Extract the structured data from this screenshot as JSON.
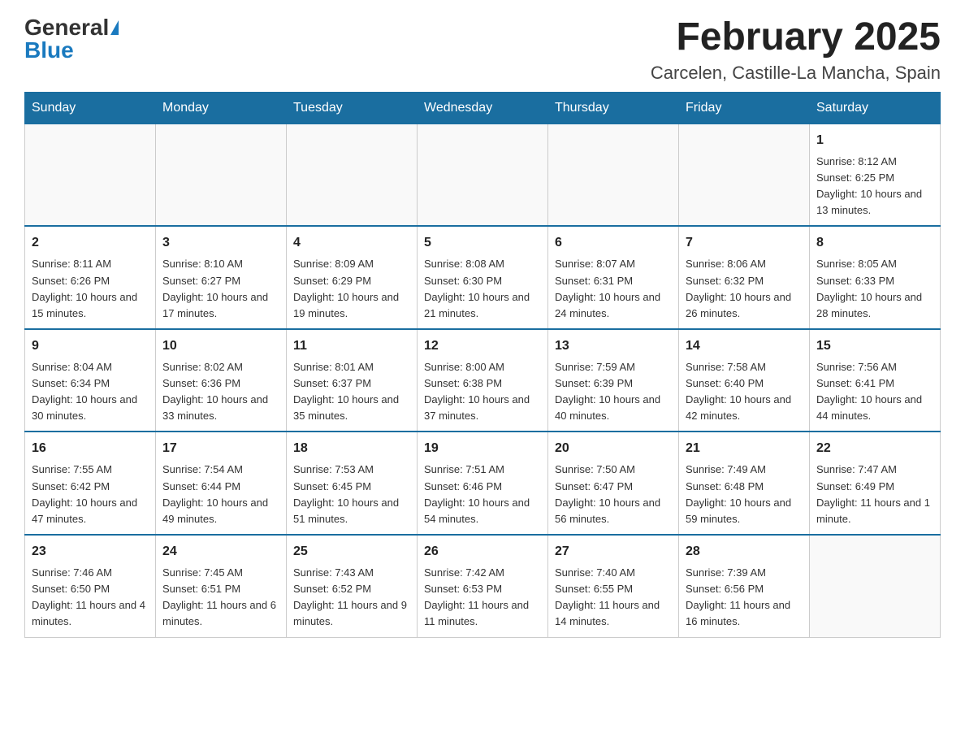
{
  "header": {
    "logo_general": "General",
    "logo_blue": "Blue",
    "month_title": "February 2025",
    "location": "Carcelen, Castille-La Mancha, Spain"
  },
  "days_of_week": [
    "Sunday",
    "Monday",
    "Tuesday",
    "Wednesday",
    "Thursday",
    "Friday",
    "Saturday"
  ],
  "weeks": [
    [
      {
        "day": "",
        "info": ""
      },
      {
        "day": "",
        "info": ""
      },
      {
        "day": "",
        "info": ""
      },
      {
        "day": "",
        "info": ""
      },
      {
        "day": "",
        "info": ""
      },
      {
        "day": "",
        "info": ""
      },
      {
        "day": "1",
        "info": "Sunrise: 8:12 AM\nSunset: 6:25 PM\nDaylight: 10 hours and 13 minutes."
      }
    ],
    [
      {
        "day": "2",
        "info": "Sunrise: 8:11 AM\nSunset: 6:26 PM\nDaylight: 10 hours and 15 minutes."
      },
      {
        "day": "3",
        "info": "Sunrise: 8:10 AM\nSunset: 6:27 PM\nDaylight: 10 hours and 17 minutes."
      },
      {
        "day": "4",
        "info": "Sunrise: 8:09 AM\nSunset: 6:29 PM\nDaylight: 10 hours and 19 minutes."
      },
      {
        "day": "5",
        "info": "Sunrise: 8:08 AM\nSunset: 6:30 PM\nDaylight: 10 hours and 21 minutes."
      },
      {
        "day": "6",
        "info": "Sunrise: 8:07 AM\nSunset: 6:31 PM\nDaylight: 10 hours and 24 minutes."
      },
      {
        "day": "7",
        "info": "Sunrise: 8:06 AM\nSunset: 6:32 PM\nDaylight: 10 hours and 26 minutes."
      },
      {
        "day": "8",
        "info": "Sunrise: 8:05 AM\nSunset: 6:33 PM\nDaylight: 10 hours and 28 minutes."
      }
    ],
    [
      {
        "day": "9",
        "info": "Sunrise: 8:04 AM\nSunset: 6:34 PM\nDaylight: 10 hours and 30 minutes."
      },
      {
        "day": "10",
        "info": "Sunrise: 8:02 AM\nSunset: 6:36 PM\nDaylight: 10 hours and 33 minutes."
      },
      {
        "day": "11",
        "info": "Sunrise: 8:01 AM\nSunset: 6:37 PM\nDaylight: 10 hours and 35 minutes."
      },
      {
        "day": "12",
        "info": "Sunrise: 8:00 AM\nSunset: 6:38 PM\nDaylight: 10 hours and 37 minutes."
      },
      {
        "day": "13",
        "info": "Sunrise: 7:59 AM\nSunset: 6:39 PM\nDaylight: 10 hours and 40 minutes."
      },
      {
        "day": "14",
        "info": "Sunrise: 7:58 AM\nSunset: 6:40 PM\nDaylight: 10 hours and 42 minutes."
      },
      {
        "day": "15",
        "info": "Sunrise: 7:56 AM\nSunset: 6:41 PM\nDaylight: 10 hours and 44 minutes."
      }
    ],
    [
      {
        "day": "16",
        "info": "Sunrise: 7:55 AM\nSunset: 6:42 PM\nDaylight: 10 hours and 47 minutes."
      },
      {
        "day": "17",
        "info": "Sunrise: 7:54 AM\nSunset: 6:44 PM\nDaylight: 10 hours and 49 minutes."
      },
      {
        "day": "18",
        "info": "Sunrise: 7:53 AM\nSunset: 6:45 PM\nDaylight: 10 hours and 51 minutes."
      },
      {
        "day": "19",
        "info": "Sunrise: 7:51 AM\nSunset: 6:46 PM\nDaylight: 10 hours and 54 minutes."
      },
      {
        "day": "20",
        "info": "Sunrise: 7:50 AM\nSunset: 6:47 PM\nDaylight: 10 hours and 56 minutes."
      },
      {
        "day": "21",
        "info": "Sunrise: 7:49 AM\nSunset: 6:48 PM\nDaylight: 10 hours and 59 minutes."
      },
      {
        "day": "22",
        "info": "Sunrise: 7:47 AM\nSunset: 6:49 PM\nDaylight: 11 hours and 1 minute."
      }
    ],
    [
      {
        "day": "23",
        "info": "Sunrise: 7:46 AM\nSunset: 6:50 PM\nDaylight: 11 hours and 4 minutes."
      },
      {
        "day": "24",
        "info": "Sunrise: 7:45 AM\nSunset: 6:51 PM\nDaylight: 11 hours and 6 minutes."
      },
      {
        "day": "25",
        "info": "Sunrise: 7:43 AM\nSunset: 6:52 PM\nDaylight: 11 hours and 9 minutes."
      },
      {
        "day": "26",
        "info": "Sunrise: 7:42 AM\nSunset: 6:53 PM\nDaylight: 11 hours and 11 minutes."
      },
      {
        "day": "27",
        "info": "Sunrise: 7:40 AM\nSunset: 6:55 PM\nDaylight: 11 hours and 14 minutes."
      },
      {
        "day": "28",
        "info": "Sunrise: 7:39 AM\nSunset: 6:56 PM\nDaylight: 11 hours and 16 minutes."
      },
      {
        "day": "",
        "info": ""
      }
    ]
  ]
}
